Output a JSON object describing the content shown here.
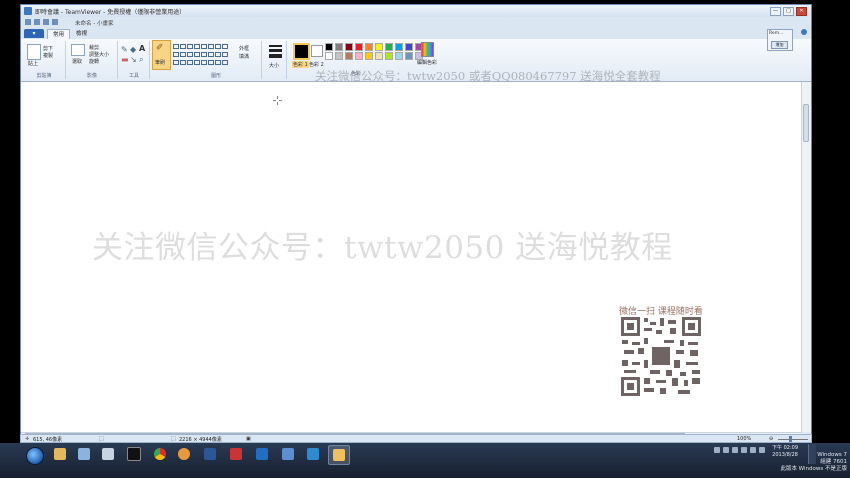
{
  "window": {
    "title": "即時會議 - TeamViewer - 免費授權（僅限非營業用途）",
    "document_title": "未命名 - 小畫家",
    "controls": [
      "—",
      "□",
      "✕"
    ]
  },
  "ribbon": {
    "app_menu_label": "▾",
    "tabs": [
      "常用",
      "檢視"
    ],
    "groups": {
      "clipboard": {
        "label": "剪貼簿",
        "paste": "貼上",
        "cut": "剪下",
        "copy": "複製"
      },
      "image": {
        "label": "影像",
        "select": "選取",
        "crop": "裁剪",
        "resize": "調整大小",
        "rotate": "旋轉"
      },
      "tools": {
        "label": "工具"
      },
      "brushes": {
        "label": "筆刷"
      },
      "shapes": {
        "label": "圖形",
        "outline": "外框",
        "fill": "填滿"
      },
      "size": {
        "label": "大小"
      },
      "color1": {
        "label": "色彩 1",
        "value": "#000000"
      },
      "color2": {
        "label": "色彩 2",
        "value": "#ffffff"
      },
      "colors": {
        "label": "色彩",
        "edit_label": "編輯色彩"
      }
    },
    "palette": [
      "#000000",
      "#7f7f7f",
      "#880015",
      "#ed1c24",
      "#ff7f27",
      "#fff200",
      "#22b14c",
      "#00a2e8",
      "#3f48cc",
      "#a349a4",
      "#ffffff",
      "#c3c3c3",
      "#b97a57",
      "#ffaec9",
      "#ffc90e",
      "#efe4b0",
      "#b5e61d",
      "#99d9ea",
      "#7092be",
      "#c8bfe7"
    ]
  },
  "mini_panel": {
    "title": "Rem...",
    "button": "增加"
  },
  "watermarks": {
    "top": "关注微信公众号：twtw2050 或者QQ080467797 送海悦全套教程",
    "big": "关注微信公众号：twtw2050 送海悦教程",
    "qr_caption": "微信一扫 课程随时看"
  },
  "statusbar": {
    "cursor_position": "615, 46像素",
    "image_size": "2216 × 4944像素",
    "zoom": "100%"
  },
  "taskbar": {
    "apps": [
      "windows-explorer",
      "paint-tool",
      "app-b",
      "cmd",
      "chrome",
      "photo-app",
      "word",
      "chart-app",
      "teamviewer",
      "app-c",
      "app-d",
      "paint-active"
    ],
    "clock_time": "下午 02:09",
    "clock_date": "2013/8/28"
  },
  "os_info": {
    "line1": "Windows 7",
    "line2": "組建 7601",
    "line3": "此版本 Windows 不是正版"
  }
}
